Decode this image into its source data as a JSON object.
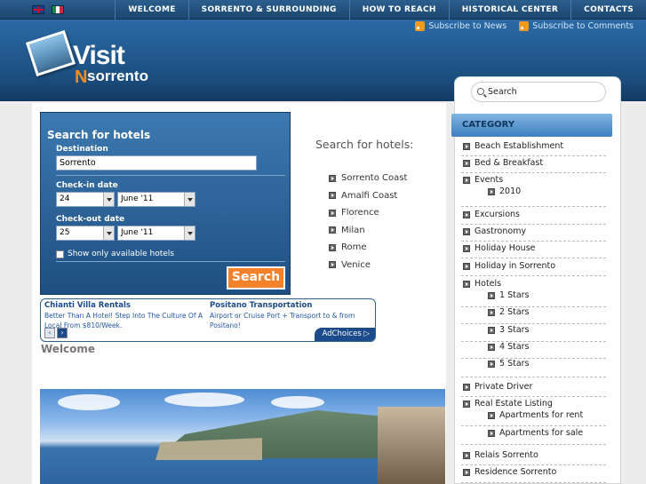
{
  "flags": [
    {
      "name": "English"
    },
    {
      "name": "Italiano"
    }
  ],
  "nav": [
    "WELCOME",
    "SORRENTO & SURROUNDING",
    "HOW TO REACH",
    "HISTORICAL CENTER",
    "CONTACTS"
  ],
  "subscribe": {
    "news": "Subscribe to News",
    "comments": "Subscribe to Comments"
  },
  "logo": {
    "visit": "Visit",
    "n": "N",
    "sorrento": "sorrento"
  },
  "hotel_search": {
    "title": "Search for hotels",
    "destination_label": "Destination",
    "destination_value": "Sorrento",
    "checkin_label": "Check-in date",
    "checkin_day": "24",
    "checkin_month": "June '11",
    "checkout_label": "Check-out date",
    "checkout_day": "25",
    "checkout_month": "June '11",
    "available_label": "Show only available hotels",
    "search_button": "Search"
  },
  "search_for_hotels": {
    "title": "Search for hotels:",
    "items": [
      "Sorrento Coast",
      "Amalfi Coast",
      "Florence",
      "Milan",
      "Rome",
      "Venice"
    ]
  },
  "ad": {
    "left_title": "Chianti Villa Rentals",
    "left_text": "Better Than A Hotel! Step Into The Culture Of A Local From $810/Week.",
    "right_title": "Positano Transportation",
    "right_text": "Airport or Cruise Port + Transport to & from Positano!",
    "prev": "‹",
    "next": "›",
    "adchoices": "AdChoices ▷"
  },
  "welcome": "Welcome",
  "sidebar": {
    "search_placeholder": "Search",
    "category_title": "CATEGORY",
    "categories": [
      {
        "label": "Beach Establishment",
        "level": 0
      },
      {
        "label": "Bed & Breakfast",
        "level": 0
      },
      {
        "label": "Events",
        "level": 0
      },
      {
        "label": "2010",
        "level": 1
      },
      {
        "label": "Excursions",
        "level": 0
      },
      {
        "label": "Gastronomy",
        "level": 0
      },
      {
        "label": "Holiday House",
        "level": 0
      },
      {
        "label": "Holiday in Sorrento",
        "level": 0
      },
      {
        "label": "Hotels",
        "level": 0
      },
      {
        "label": "1 Stars",
        "level": 2
      },
      {
        "label": "2 Stars",
        "level": 2
      },
      {
        "label": "3 Stars",
        "level": 2
      },
      {
        "label": "4 Stars",
        "level": 2
      },
      {
        "label": "5 Stars",
        "level": 2
      },
      {
        "label": "Private Driver",
        "level": 0
      },
      {
        "label": "Real Estate Listing",
        "level": 0
      },
      {
        "label": "Apartments for rent",
        "level": 2
      },
      {
        "label": "Apartments for sale",
        "level": 2
      },
      {
        "label": "Relais Sorrento",
        "level": 0
      },
      {
        "label": "Residence Sorrento",
        "level": 0
      }
    ]
  }
}
